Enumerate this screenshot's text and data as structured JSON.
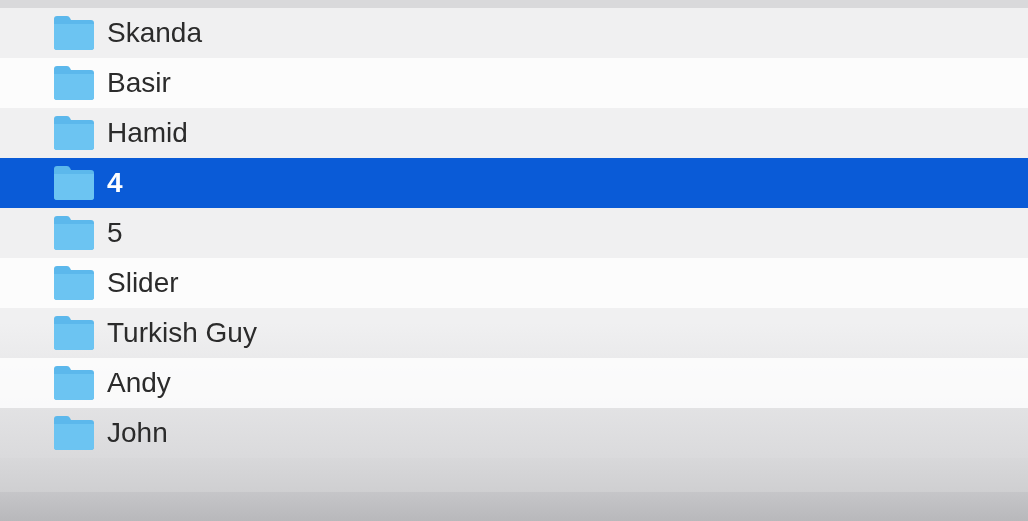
{
  "files": [
    {
      "name": "Skanda",
      "selected": false
    },
    {
      "name": "Basir",
      "selected": false
    },
    {
      "name": "Hamid",
      "selected": false
    },
    {
      "name": "4",
      "selected": true
    },
    {
      "name": "5",
      "selected": false
    },
    {
      "name": "Slider",
      "selected": false
    },
    {
      "name": "Turkish Guy",
      "selected": false
    },
    {
      "name": "Andy",
      "selected": false
    },
    {
      "name": "John",
      "selected": false
    }
  ]
}
